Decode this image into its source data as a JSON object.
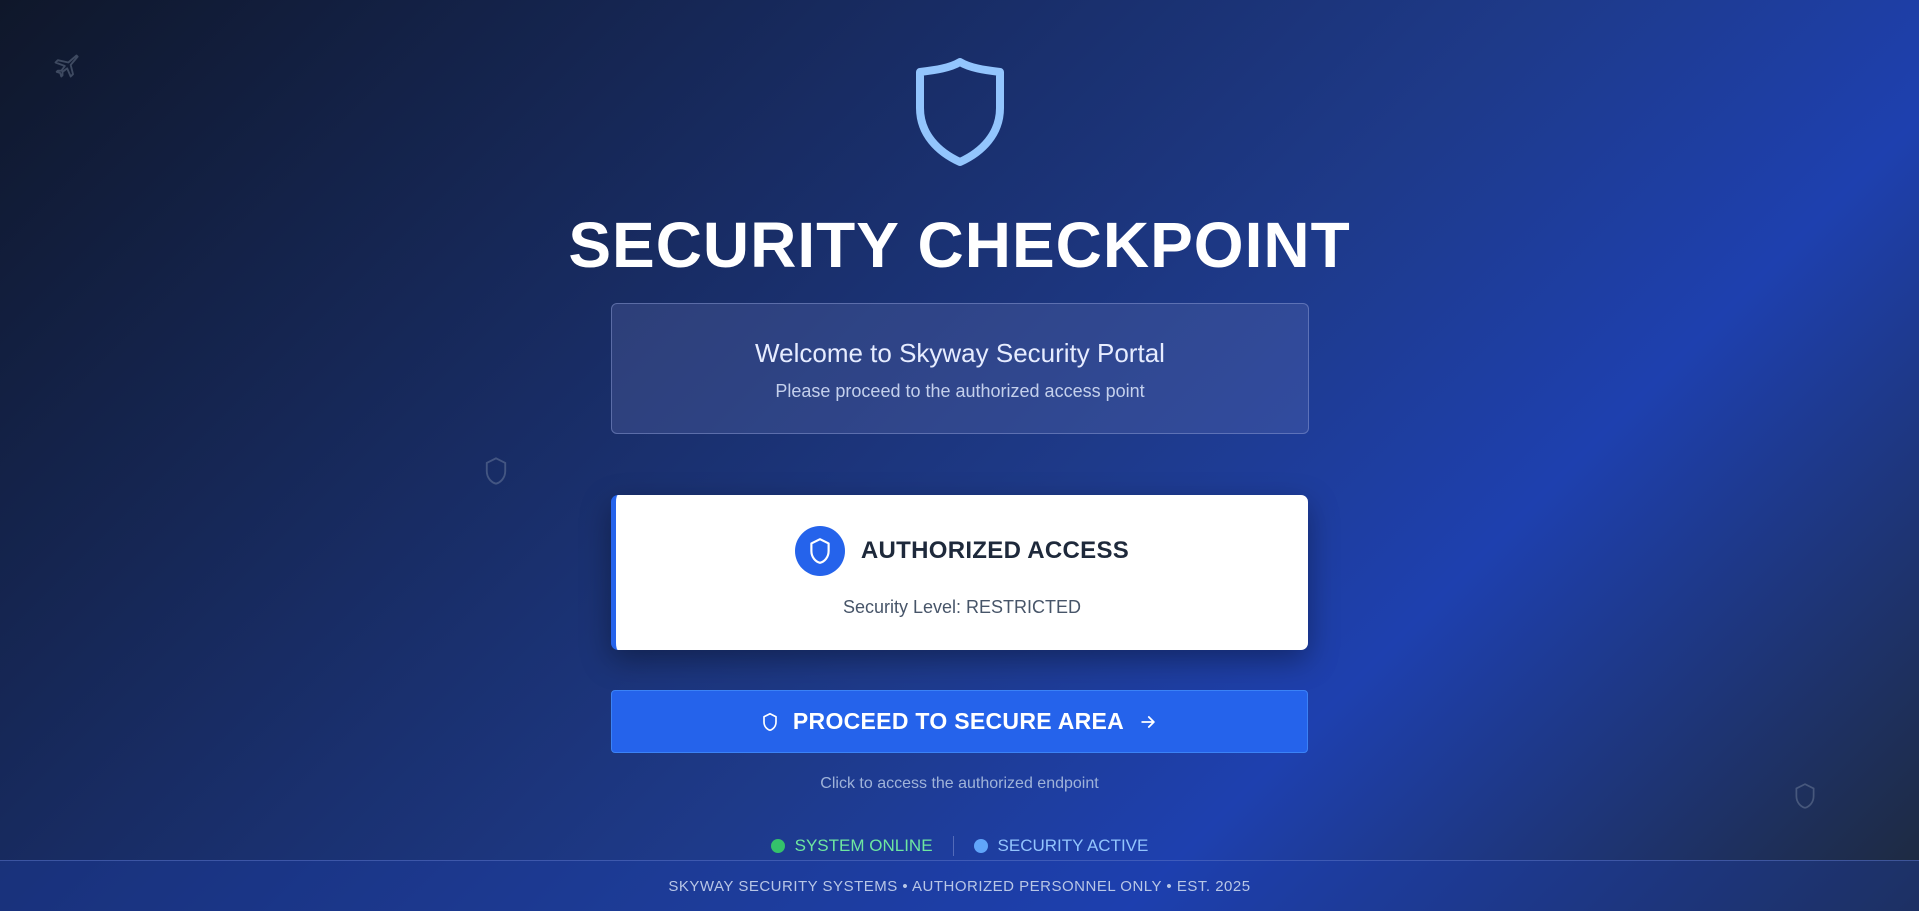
{
  "colors": {
    "accent": "#2563eb",
    "hero_icon": "#93c5fd",
    "status_online": "#34c26b",
    "status_active": "#60a5fa"
  },
  "decorations": [
    "airplane-icon",
    "shield-icon",
    "shield-icon"
  ],
  "hero": {
    "icon": "shield-icon",
    "title": "SECURITY CHECKPOINT"
  },
  "welcome": {
    "title": "Welcome to Skyway Security Portal",
    "subtitle": "Please proceed to the authorized access point"
  },
  "access_card": {
    "icon": "shield-icon",
    "title": "AUTHORIZED ACCESS",
    "level": "Security Level: RESTRICTED"
  },
  "proceed": {
    "label": "PROCEED TO SECURE AREA",
    "icon_left": "shield-icon",
    "icon_right": "arrow-right-icon",
    "hint": "Click to access the authorized endpoint"
  },
  "status": {
    "online": "SYSTEM ONLINE",
    "active": "SECURITY ACTIVE"
  },
  "footer": {
    "text": "SKYWAY SECURITY SYSTEMS • AUTHORIZED PERSONNEL ONLY • EST. 2025"
  }
}
